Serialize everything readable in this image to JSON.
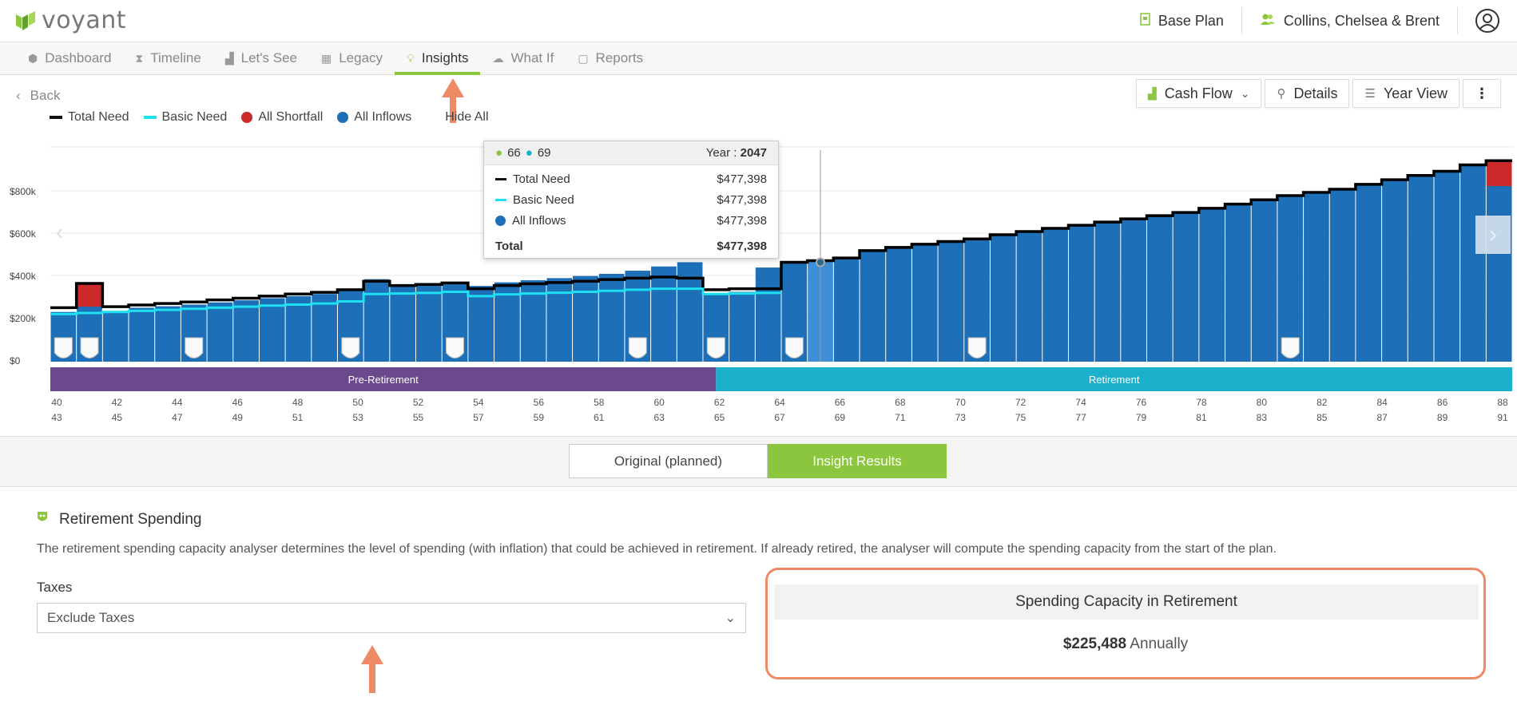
{
  "app": {
    "logo_text": "voyant"
  },
  "header": {
    "plan_label": "Base Plan",
    "client_label": "Collins, Chelsea & Brent",
    "profile_icon": "user-circle-icon"
  },
  "nav": {
    "tabs": [
      {
        "label": "Dashboard",
        "icon": "cube-icon",
        "active": false
      },
      {
        "label": "Timeline",
        "icon": "hourglass-icon",
        "active": false
      },
      {
        "label": "Let's See",
        "icon": "bar-chart-icon",
        "active": false
      },
      {
        "label": "Legacy",
        "icon": "gift-icon",
        "active": false
      },
      {
        "label": "Insights",
        "icon": "lightbulb-icon",
        "active": true
      },
      {
        "label": "What If",
        "icon": "brain-icon",
        "active": false
      },
      {
        "label": "Reports",
        "icon": "document-icon",
        "active": false
      }
    ]
  },
  "back_label": "Back",
  "toolbar": {
    "cash_flow_label": "Cash Flow",
    "details_label": "Details",
    "year_view_label": "Year View"
  },
  "legend": {
    "items": [
      {
        "label": "Total Need",
        "color": "#111111",
        "kind": "line"
      },
      {
        "label": "Basic Need",
        "color": "#1ee0f0",
        "kind": "line"
      },
      {
        "label": "All Shortfall",
        "color": "#cc2a2a",
        "kind": "dot"
      },
      {
        "label": "All Inflows",
        "color": "#1d6fb8",
        "kind": "dot"
      }
    ],
    "hide_all_label": "Hide All"
  },
  "tooltip": {
    "age_1": "66",
    "age_2": "69",
    "year_label": "Year :",
    "year": "2047",
    "rows": [
      {
        "label": "Total Need",
        "value": "$477,398"
      },
      {
        "label": "Basic Need",
        "value": "$477,398"
      },
      {
        "label": "All Inflows",
        "value": "$477,398"
      }
    ],
    "total_label": "Total",
    "total_value": "$477,398"
  },
  "chart_data": {
    "type": "bar",
    "ylabel_ticks": [
      "$0",
      "$200k",
      "$400k",
      "$600k",
      "$800k"
    ],
    "ylim": [
      0,
      1000000
    ],
    "x_ages_1": [
      40,
      41,
      42,
      43,
      44,
      45,
      46,
      47,
      48,
      49,
      50,
      51,
      52,
      53,
      54,
      55,
      56,
      57,
      58,
      59,
      60,
      61,
      62,
      63,
      64,
      65,
      66,
      67,
      68,
      69,
      70,
      71,
      72,
      73,
      74,
      75,
      76,
      77,
      78,
      79,
      80,
      81,
      82,
      83,
      84,
      85,
      86,
      87,
      88,
      89
    ],
    "tick_ages_1": [
      "40",
      "42",
      "44",
      "46",
      "48",
      "50",
      "52",
      "54",
      "56",
      "58",
      "60",
      "62",
      "64",
      "66",
      "68",
      "70",
      "72",
      "74",
      "76",
      "78",
      "80",
      "82",
      "84",
      "86",
      "88"
    ],
    "tick_ages_2": [
      "43",
      "45",
      "47",
      "49",
      "51",
      "53",
      "55",
      "57",
      "59",
      "61",
      "63",
      "65",
      "67",
      "69",
      "71",
      "73",
      "75",
      "77",
      "79",
      "81",
      "83",
      "85",
      "87",
      "89",
      "91"
    ],
    "series": [
      {
        "name": "All Inflows",
        "values": [
          235000,
          265000,
          240000,
          255000,
          262000,
          270000,
          280000,
          290000,
          300000,
          310000,
          320000,
          338000,
          390000,
          355000,
          360000,
          370000,
          358000,
          375000,
          385000,
          395000,
          405000,
          415000,
          430000,
          450000,
          470000,
          320000,
          330000,
          445000,
          465000,
          477398,
          490000,
          525000,
          540000,
          555000,
          568000,
          580000,
          600000,
          615000,
          630000,
          645000,
          660000,
          675000,
          690000,
          705000,
          725000,
          745000,
          765000,
          785000,
          800000,
          815000,
          838000,
          860000,
          880000,
          900000,
          930000,
          950000
        ]
      },
      {
        "name": "Total Need",
        "values": [
          255000,
          370000,
          260000,
          268000,
          275000,
          282000,
          292000,
          300000,
          310000,
          320000,
          328000,
          340000,
          380000,
          360000,
          365000,
          372000,
          345000,
          360000,
          368000,
          374000,
          380000,
          388000,
          395000,
          400000,
          395000,
          340000,
          345000,
          345000,
          470000,
          477398,
          490000,
          525000,
          540000,
          555000,
          568000,
          580000,
          600000,
          615000,
          630000,
          645000,
          660000,
          675000,
          690000,
          705000,
          725000,
          745000,
          765000,
          785000,
          800000,
          815000,
          838000,
          860000,
          880000,
          900000,
          930000,
          950000
        ]
      },
      {
        "name": "Basic Need",
        "values": [
          225000,
          230000,
          235000,
          240000,
          245000,
          250000,
          255000,
          260000,
          265000,
          270000,
          275000,
          285000,
          320000,
          322000,
          325000,
          330000,
          310000,
          318000,
          322000,
          326000,
          330000,
          335000,
          340000,
          345000,
          345000,
          320000,
          322000,
          325000
        ]
      },
      {
        "name": "All Shortfall",
        "values": [
          0,
          110000,
          0,
          0,
          0,
          0,
          0,
          0,
          0,
          0,
          0,
          0,
          0,
          0,
          0,
          0,
          0,
          0,
          0,
          0,
          0,
          0,
          0,
          0,
          0,
          0,
          0,
          0,
          0,
          0,
          0,
          0,
          0,
          0,
          0,
          0,
          0,
          0,
          0,
          0,
          0,
          0,
          0,
          0,
          0,
          0,
          0,
          0,
          0,
          0,
          0,
          0,
          0,
          0,
          0,
          120000
        ]
      }
    ],
    "phases": [
      {
        "label": "Pre-Retirement",
        "color": "#6a4a8c"
      },
      {
        "label": "Retirement",
        "color": "#1bb0cc"
      }
    ]
  },
  "toggle": {
    "original_label": "Original (planned)",
    "insight_label": "Insight Results"
  },
  "insight": {
    "title": "Retirement Spending",
    "description": "The retirement spending capacity analyser determines the level of spending (with inflation) that could be achieved in retirement. If already retired, the analyser will compute the spending capacity from the start of the plan.",
    "taxes_label": "Taxes",
    "taxes_value": "Exclude Taxes",
    "capacity_title": "Spending Capacity in Retirement",
    "capacity_amount": "$225,488",
    "capacity_period": "Annually"
  },
  "colors": {
    "brand_green": "#8cc63f",
    "bar_blue": "#1d6fb8",
    "highlight_orange": "#ef8a66"
  }
}
